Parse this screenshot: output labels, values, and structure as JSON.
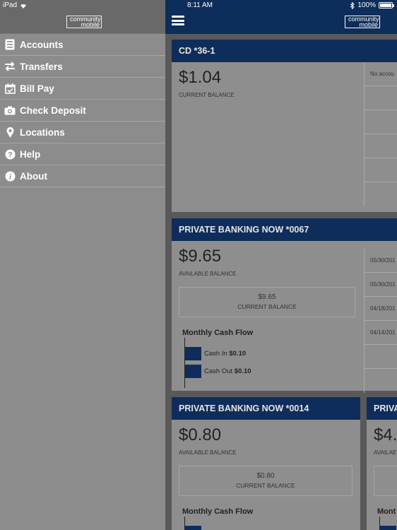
{
  "status_bar": {
    "device": "iPad",
    "time": "8:11 AM",
    "battery": "100%"
  },
  "logo": {
    "line1": "community",
    "line2": "mobile"
  },
  "sidebar": {
    "items": [
      {
        "label": "Accounts",
        "icon": "accounts-icon"
      },
      {
        "label": "Transfers",
        "icon": "transfers-icon"
      },
      {
        "label": "Bill Pay",
        "icon": "bill-pay-icon"
      },
      {
        "label": "Check Deposit",
        "icon": "camera-icon"
      },
      {
        "label": "Locations",
        "icon": "location-pin-icon"
      },
      {
        "label": "Help",
        "icon": "help-icon"
      },
      {
        "label": "About",
        "icon": "info-icon"
      }
    ]
  },
  "cards": [
    {
      "title": "CD *36-1",
      "amount": "$1.04",
      "amount_label": "CURRENT BALANCE",
      "transactions": [
        "No accou",
        "",
        "",
        "",
        "",
        ""
      ]
    },
    {
      "title": "PRIVATE BANKING NOW *0067",
      "amount": "$9.65",
      "amount_label": "AVAILABLE BALANCE",
      "current_balance": "$9.65",
      "current_label": "CURRENT BALANCE",
      "cashflow_title": "Monthly Cash Flow",
      "cash_in_label": "Cash In",
      "cash_in": "$0.10",
      "cash_out_label": "Cash Out",
      "cash_out": "$0.10",
      "transactions": [
        "05/30/201",
        "05/30/201",
        "04/18/201",
        "04/14/201",
        "",
        ""
      ]
    },
    {
      "title": "PRIVATE BANKING NOW *0014",
      "amount": "$0.80",
      "amount_label": "AVAILABLE BALANCE",
      "current_balance": "$0.80",
      "current_label": "CURRENT BALANCE",
      "cashflow_title": "Monthly Cash Flow"
    },
    {
      "title": "PRIVA",
      "amount": "$4.",
      "amount_label": "AVAILAE",
      "cashflow_title": "Mont"
    }
  ]
}
